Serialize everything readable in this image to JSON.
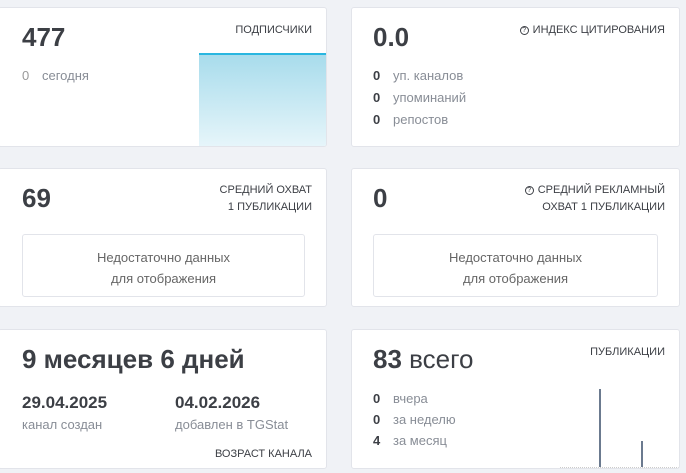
{
  "subscribers": {
    "value": "477",
    "label": "ПОДПИСЧИКИ",
    "today_count": "0",
    "today_label": "сегодня"
  },
  "citation": {
    "value": "0.0",
    "label": "ИНДЕКС ЦИТИРОВАНИЯ",
    "rows": [
      {
        "n": "0",
        "t": "уп. каналов"
      },
      {
        "n": "0",
        "t": "упоминаний"
      },
      {
        "n": "0",
        "t": "репостов"
      }
    ]
  },
  "avg_reach": {
    "value": "69",
    "label1": "СРЕДНИЙ ОХВАТ",
    "label2": "1 ПУБЛИКАЦИИ",
    "nodata1": "Недостаточно данных",
    "nodata2": "для отображения"
  },
  "avg_ad_reach": {
    "value": "0",
    "label1": "СРЕДНИЙ РЕКЛАМНЫЙ",
    "label2": "ОХВАТ 1 ПУБЛИКАЦИИ",
    "nodata1": "Недостаточно данных",
    "nodata2": "для отображения"
  },
  "age": {
    "value": "9 месяцев 6 дней",
    "created_date": "29.04.2025",
    "created_label": "канал создан",
    "added_date": "04.02.2026",
    "added_label": "добавлен в TGStat",
    "label": "ВОЗРАСТ КАНАЛА"
  },
  "posts": {
    "count": "83",
    "count_suffix": "всего",
    "label": "ПУБЛИКАЦИИ",
    "rows": [
      {
        "n": "0",
        "t": "вчера"
      },
      {
        "n": "0",
        "t": "за неделю"
      },
      {
        "n": "4",
        "t": "за месяц"
      }
    ],
    "bars": [
      3,
      1
    ]
  },
  "colors": {
    "accent": "#29b6e0",
    "bar": "#6b7a8f"
  }
}
